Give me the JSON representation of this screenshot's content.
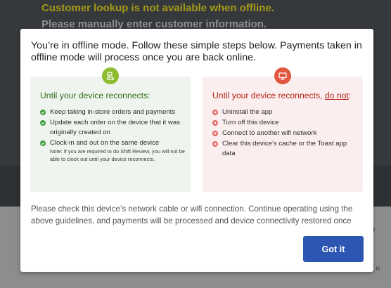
{
  "background": {
    "warning_line": "Customer lookup is not available when offline.",
    "info_line": "Please manually enter customer information.",
    "edge_glyph_1": "r",
    "edge_glyph_2": "o"
  },
  "modal": {
    "title": "You’re in offline mode. Follow these simple steps below. Payments taken in offline mode will process once you are back online.",
    "do_card": {
      "icon": "pos-terminal-icon",
      "heading": "Until your device reconnects:",
      "items": [
        "Keep taking in-store orders and payments",
        "Update each order on the device that it was originally created on",
        "Clock-in and out on the same device"
      ],
      "note": "Note: If you are required to do Shift Review, you will not be able to clock out until your device reconnects."
    },
    "dont_card": {
      "icon": "kds-screen-icon",
      "heading_prefix": "Until your device reconnects, ",
      "heading_emphasis": "do not",
      "heading_suffix": ":",
      "items": [
        "Uninstall the app",
        "Turn off this device",
        "Connect to another wifi network",
        "Clear this device’s cache or the Toast app data"
      ]
    },
    "footer_text": "Please check this device’s network cable or wifi connection. Continue operating using the above guidelines, and payments will be processed and device connectivity restored once",
    "got_it_label": "Got it"
  },
  "colors": {
    "do_accent": "#8dbd2f",
    "dont_accent": "#e2573f",
    "primary_button": "#2d56b2",
    "warning_text": "#a49a17"
  }
}
